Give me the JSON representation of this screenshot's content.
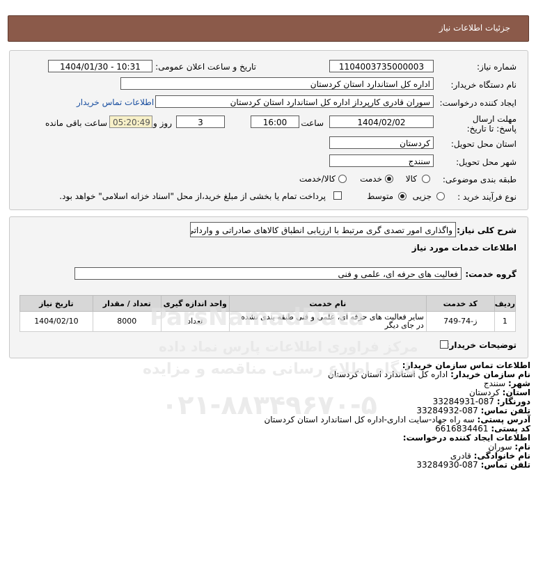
{
  "header": {
    "title": "جزئیات اطلاعات نیاز"
  },
  "form": {
    "need_number_label": "شماره نیاز:",
    "need_number": "1104003735000003",
    "announce_label": "تاریخ و ساعت اعلان عمومی:",
    "announce_value": "1404/01/30 - 10:31",
    "buyer_org_label": "نام دستگاه خریدار:",
    "buyer_org": "اداره کل استاندارد استان کردستان",
    "creator_label": "ایجاد کننده درخواست:",
    "creator": "سوران قادری کارپرداز اداره کل استاندارد استان کردستان",
    "contact_link": "اطلاعات تماس خریدار",
    "deadline_label": "مهلت ارسال پاسخ: تا تاریخ:",
    "deadline_date": "1404/02/02",
    "time_label": "ساعت",
    "deadline_time": "16:00",
    "days_value": "3",
    "days_label": "روز و",
    "remaining_time": "05:20:49",
    "remaining_label": "ساعت باقی مانده",
    "province_label": "استان محل تحویل:",
    "province": "کردستان",
    "city_label": "شهر محل تحویل:",
    "city": "سنندج",
    "category_label": "طبقه بندی موضوعی:",
    "category_options": [
      "کالا",
      "خدمت",
      "کالا/خدمت"
    ],
    "category_selected": "خدمت",
    "process_label": "نوع فرآیند خرید :",
    "process_options": [
      "جزیی",
      "متوسط"
    ],
    "process_selected": "متوسط",
    "payment_note": "پرداخت تمام یا بخشی از مبلغ خرید،از محل \"اسناد خزانه اسلامی\" خواهد بود."
  },
  "details": {
    "summary_label": "شرح کلی نیاز:",
    "summary": "واگذاری امور تصدی گری مرتبط با ارزیابی انطباق کالاهای صادراتی و وارداتی",
    "services_heading": "اطلاعات خدمات مورد نیاز",
    "service_group_label": "گروه خدمت:",
    "service_group": "فعالیت های حرفه ای، علمی و فنی",
    "table": {
      "headers": [
        "ردیف",
        "کد خدمت",
        "نام خدمت",
        "واحد اندازه گیری",
        "تعداد / مقدار",
        "تاریخ نیاز"
      ],
      "rows": [
        [
          "1",
          "ز-74-749",
          "سایر فعالیت های حرفه ای، علمی و فنی طبقه بندی نشده در جای دیگر",
          "تعداد",
          "8000",
          "1404/02/10"
        ]
      ]
    },
    "buyer_notes_label": "توضیحات خریدار:"
  },
  "contact": {
    "org_heading": "اطلاعات تماس سازمان خریدار:",
    "org_name_label": "نام سازمان خریدار:",
    "org_name": "اداره کل استاندارد استان کردستان",
    "city_label": "شهر:",
    "city": "سنندج",
    "province_label": "استان:",
    "province": "کردستان",
    "fax_label": "دورنگار:",
    "fax": "087-33284931",
    "phone_label": "تلفن تماس:",
    "phone": "087-33284932",
    "address_label": "آدرس پستی:",
    "address": "سه راه جهاد-سایت اداری-اداره کل استاندارد استان کردستان",
    "postal_label": "کد پستی:",
    "postal": "6616834461",
    "creator_heading": "اطلاعات ایجاد کننده درخواست:",
    "first_name_label": "نام:",
    "first_name": "سوران",
    "last_name_label": "نام خانوادگی:",
    "last_name": "قادری",
    "creator_phone_label": "تلفن تماس:",
    "creator_phone": "087-33284930"
  },
  "watermark": {
    "brand": "ParsNamadData",
    "line1": "مرکز فراوری اطلاعات پارس نماد داده",
    "line2": "پایگاه اطلاع رسانی مناقصه و مزایده",
    "phone": "۰۲۱-۸۸۳۴۹۶۷۰-۵"
  }
}
